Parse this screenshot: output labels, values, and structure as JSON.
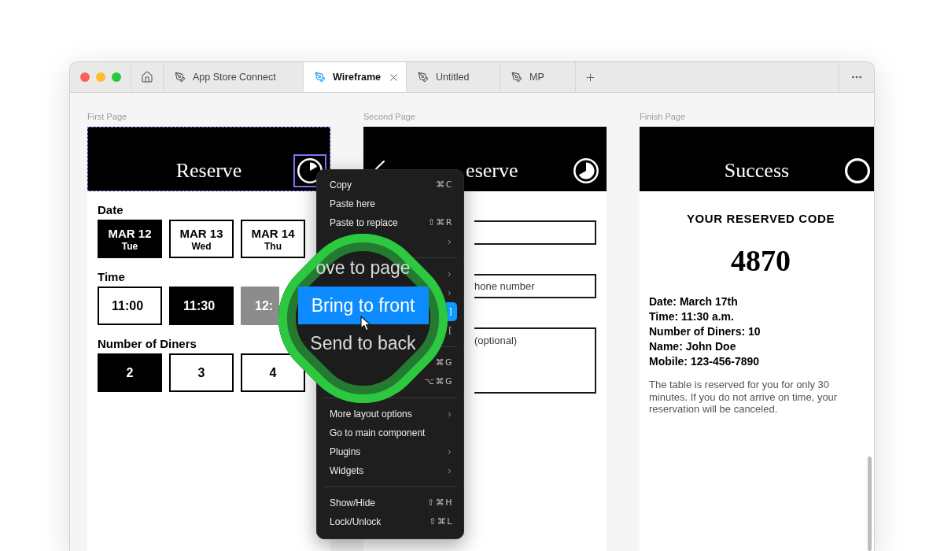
{
  "tabs": [
    {
      "label": "App Store Connect",
      "selected": false
    },
    {
      "label": "Wireframe",
      "selected": true
    },
    {
      "label": "Untitled",
      "selected": false
    },
    {
      "label": "MP",
      "selected": false
    }
  ],
  "canvas": {
    "frames": [
      {
        "kind": "booking",
        "label": "First Page",
        "header": {
          "title": "Reserve",
          "icon": {
            "kind": "sixth"
          },
          "selected": true,
          "icon_selected": true,
          "back": false
        },
        "sections": [
          {
            "kind": "date",
            "title": "Date",
            "options": [
              {
                "label": "MAR 12",
                "sublabel": "Tue",
                "selected": true,
                "disabled": false
              },
              {
                "label": "MAR 13",
                "sublabel": "Wed",
                "selected": false,
                "disabled": false
              },
              {
                "label": "MAR 14",
                "sublabel": "Thu",
                "selected": false,
                "disabled": false
              }
            ]
          },
          {
            "kind": "time",
            "title": "Time",
            "options": [
              {
                "label": "11:00",
                "selected": false,
                "disabled": false
              },
              {
                "label": "11:30",
                "selected": true,
                "disabled": false
              },
              {
                "label": "12:",
                "selected": false,
                "disabled": true
              }
            ]
          },
          {
            "kind": "count",
            "title": "Number of Diners",
            "options": [
              {
                "label": "2",
                "selected": true,
                "disabled": false
              },
              {
                "label": "3",
                "selected": false,
                "disabled": false
              },
              {
                "label": "4",
                "selected": false,
                "disabled": false
              }
            ]
          }
        ]
      },
      {
        "kind": "details",
        "label": "Second Page",
        "header": {
          "title": "eserve",
          "icon": {
            "kind": "twothirds"
          },
          "selected": false,
          "icon_selected": false,
          "back": true
        },
        "fields": [
          {
            "kind": "input"
          },
          {
            "kind": "input",
            "placeholder": "hone number"
          },
          {
            "kind": "textarea",
            "placeholder": "(optional)"
          }
        ]
      },
      {
        "kind": "success",
        "label": "Finish Page",
        "header": {
          "title": "Success",
          "icon": {
            "kind": "ring"
          },
          "selected": false,
          "icon_selected": false,
          "back": false
        },
        "code_title": "YOUR RESERVED CODE",
        "code": "4870",
        "details": [
          "Date: March 17th",
          "Time: 11:30 a.m.",
          "Number of Diners: 10",
          "Name: John Doe",
          "Mobile: 123-456-7890"
        ],
        "note": "The table is reserved for you for only 30 minutes. If you do not arrive on time, your reservation will be canceled."
      }
    ]
  },
  "context_menu": {
    "groups": [
      {
        "items": [
          {
            "label": "Copy",
            "shortcut": "⌘C",
            "submenu": false,
            "highlighted": false
          },
          {
            "label": "Paste here",
            "submenu": false,
            "highlighted": false
          },
          {
            "label": "Paste to replace",
            "shortcut": "⇧⌘R",
            "submenu": false,
            "highlighted": false
          },
          {
            "submenu": true,
            "highlighted": false
          }
        ]
      },
      {
        "items": [
          {
            "submenu": true,
            "highlighted": false
          },
          {
            "submenu": true,
            "highlighted": false
          },
          {
            "shortcut": "]",
            "submenu": false,
            "highlighted": true
          },
          {
            "shortcut": "[",
            "submenu": false,
            "highlighted": false
          }
        ]
      },
      {
        "items": [
          {
            "shortcut": "⌘G",
            "submenu": false,
            "highlighted": false
          },
          {
            "shortcut": "⌥⌘G",
            "submenu": false,
            "highlighted": false
          }
        ]
      },
      {
        "items": [
          {
            "label": "More layout options",
            "submenu": true,
            "highlighted": false
          },
          {
            "label": "Go to main component",
            "submenu": false,
            "highlighted": false
          },
          {
            "label": "Plugins",
            "submenu": true,
            "highlighted": false
          },
          {
            "label": "Widgets",
            "submenu": true,
            "highlighted": false
          }
        ]
      },
      {
        "items": [
          {
            "label": "Show/Hide",
            "shortcut": "⇧⌘H",
            "submenu": false,
            "highlighted": false
          },
          {
            "label": "Lock/Unlock",
            "shortcut": "⇧⌘L",
            "submenu": false,
            "highlighted": false
          }
        ]
      }
    ]
  },
  "magnifier": {
    "items": [
      {
        "label": "ove to page",
        "highlighted": false
      },
      {
        "label": "Bring to front",
        "highlighted": true
      },
      {
        "label": "Send to back",
        "highlighted": false
      }
    ]
  }
}
